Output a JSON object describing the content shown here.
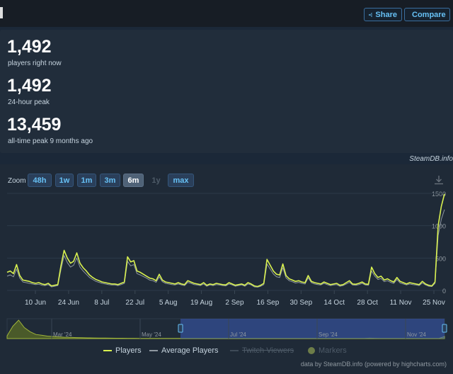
{
  "header": {
    "share_label": "Share",
    "compare_label": "Compare"
  },
  "stats": [
    {
      "value": "1,492",
      "label": "players right now"
    },
    {
      "value": "1,492",
      "label": "24-hour peak"
    },
    {
      "value": "13,459",
      "label": "all-time peak 9 months ago"
    }
  ],
  "credit": "SteamDB.info",
  "zoom": {
    "label": "Zoom",
    "buttons": [
      {
        "label": "48h",
        "state": "normal"
      },
      {
        "label": "1w",
        "state": "normal"
      },
      {
        "label": "1m",
        "state": "normal"
      },
      {
        "label": "3m",
        "state": "normal"
      },
      {
        "label": "6m",
        "state": "active"
      },
      {
        "label": "1y",
        "state": "disabled"
      },
      {
        "label": "max",
        "state": "normal"
      }
    ]
  },
  "chart_data": {
    "type": "line",
    "x_ticks": [
      "10 Jun",
      "24 Jun",
      "8 Jul",
      "22 Jul",
      "5 Aug",
      "19 Aug",
      "2 Sep",
      "16 Sep",
      "30 Sep",
      "14 Oct",
      "28 Oct",
      "11 Nov",
      "25 Nov"
    ],
    "y_ticks": [
      "0",
      "500",
      "1000",
      "1500"
    ],
    "ylim": [
      0,
      1500
    ],
    "grid": true,
    "series": [
      {
        "name": "Players",
        "color": "#d9f150",
        "values": [
          280,
          300,
          260,
          400,
          230,
          160,
          150,
          140,
          120,
          110,
          120,
          100,
          90,
          110,
          70,
          80,
          90,
          380,
          620,
          500,
          420,
          450,
          580,
          420,
          350,
          300,
          240,
          200,
          170,
          150,
          130,
          120,
          110,
          100,
          100,
          90,
          110,
          130,
          520,
          440,
          460,
          300,
          280,
          250,
          220,
          190,
          180,
          150,
          250,
          160,
          130,
          120,
          110,
          100,
          120,
          100,
          90,
          150,
          130,
          110,
          100,
          90,
          120,
          80,
          100,
          90,
          110,
          100,
          90,
          85,
          120,
          100,
          80,
          90,
          100,
          80,
          120,
          100,
          70,
          60,
          80,
          110,
          480,
          390,
          300,
          250,
          240,
          410,
          230,
          180,
          160,
          140,
          150,
          130,
          120,
          230,
          140,
          120,
          110,
          100,
          130,
          110,
          90,
          100,
          110,
          80,
          90,
          120,
          150,
          100,
          95,
          110,
          130,
          100,
          95,
          360,
          260,
          200,
          220,
          160,
          180,
          150,
          130,
          200,
          140,
          120,
          100,
          120,
          110,
          100,
          90,
          140,
          100,
          80,
          70,
          130,
          1000,
          1300,
          1492
        ]
      },
      {
        "name": "Average Players",
        "color": "#8f98a0",
        "values": [
          220,
          240,
          210,
          330,
          190,
          130,
          120,
          110,
          100,
          90,
          95,
          80,
          75,
          90,
          55,
          65,
          75,
          320,
          540,
          430,
          360,
          390,
          500,
          360,
          300,
          250,
          200,
          170,
          140,
          125,
          110,
          100,
          90,
          85,
          85,
          75,
          90,
          110,
          450,
          380,
          400,
          260,
          240,
          215,
          190,
          160,
          150,
          125,
          210,
          135,
          110,
          100,
          90,
          85,
          100,
          85,
          75,
          125,
          110,
          90,
          85,
          75,
          100,
          65,
          85,
          75,
          90,
          85,
          75,
          70,
          100,
          85,
          65,
          75,
          85,
          65,
          100,
          85,
          55,
          50,
          65,
          90,
          410,
          330,
          255,
          210,
          200,
          350,
          195,
          150,
          135,
          115,
          125,
          110,
          100,
          195,
          120,
          100,
          90,
          85,
          110,
          90,
          75,
          85,
          90,
          65,
          75,
          100,
          125,
          85,
          80,
          90,
          110,
          85,
          80,
          300,
          220,
          170,
          185,
          135,
          150,
          125,
          110,
          170,
          115,
          100,
          85,
          100,
          90,
          85,
          75,
          115,
          85,
          65,
          60,
          110,
          850,
          1100,
          1250
        ]
      }
    ],
    "navigator": {
      "ticks": [
        "Mar '24",
        "May '24",
        "Jul '24",
        "Sep '24",
        "Nov '24"
      ],
      "values": [
        2000,
        9000,
        13459,
        8000,
        5000,
        3000,
        2500,
        1800,
        1500,
        1200,
        1000,
        900,
        700,
        600,
        500,
        450,
        400,
        380,
        300,
        260,
        240,
        220,
        200,
        180,
        160,
        150,
        140,
        130,
        120,
        110,
        100,
        100,
        90,
        120,
        150,
        120,
        100,
        110,
        120,
        100,
        90,
        100,
        120,
        110,
        100,
        90,
        110,
        130,
        100,
        90,
        100,
        110,
        100,
        90,
        120,
        100,
        95,
        110,
        130,
        100,
        90,
        100,
        120,
        300,
        200,
        150,
        130,
        100,
        90,
        120,
        100,
        90,
        100,
        110,
        100,
        90,
        1492
      ]
    }
  },
  "legend": [
    {
      "label": "Players",
      "color": "#d9f150",
      "visible": true
    },
    {
      "label": "Average Players",
      "color": "#8f98a0",
      "visible": true
    },
    {
      "label": "Twitch Viewers",
      "color": "#3e4a57",
      "visible": false
    },
    {
      "label": "Markers",
      "color": "#6d7d49",
      "visible": false
    }
  ],
  "footer": "data by SteamDB.info (powered by highcharts.com)"
}
